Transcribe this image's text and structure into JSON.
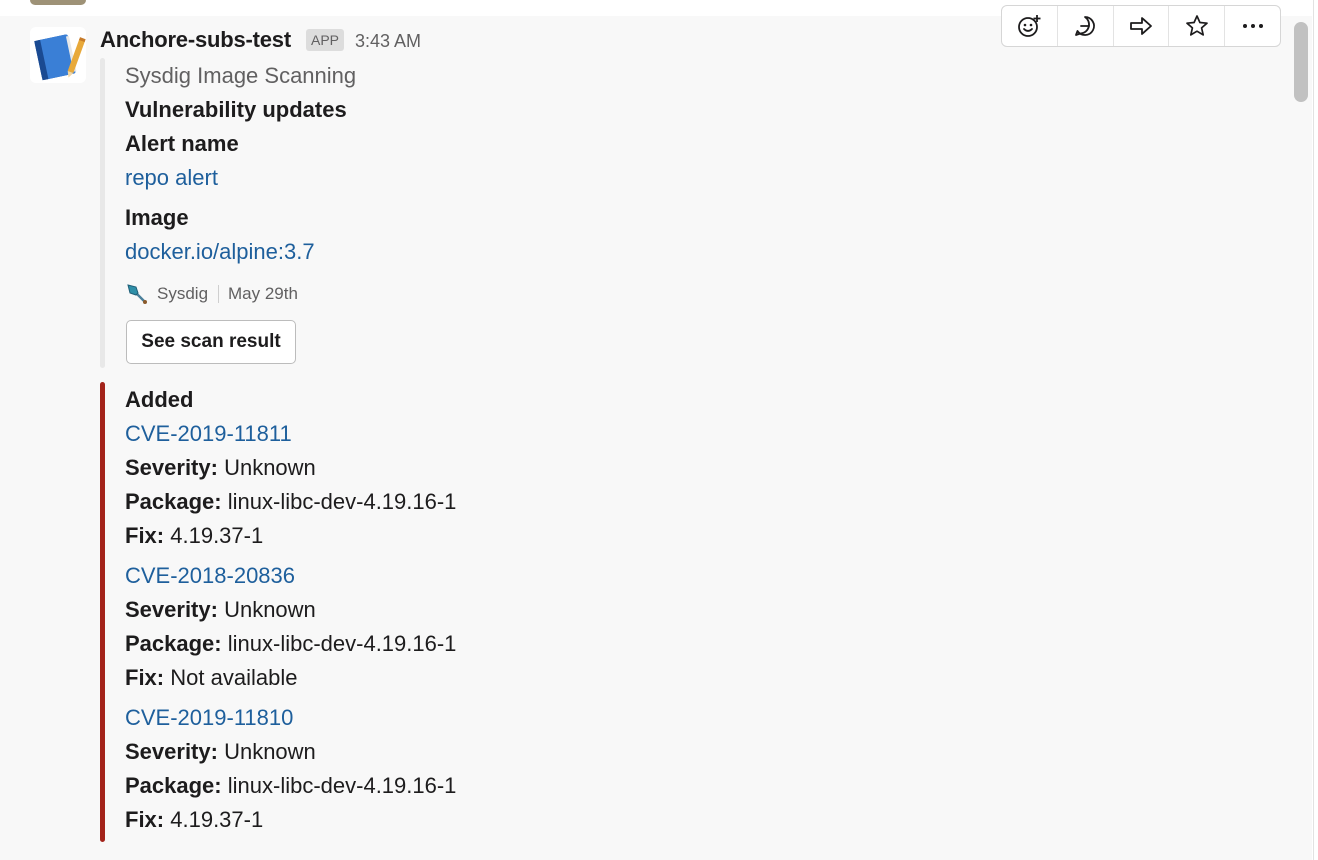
{
  "message": {
    "sender": "Anchore-subs-test",
    "badge": "APP",
    "time": "3:43 AM"
  },
  "attachment": {
    "pretext": "Sysdig Image Scanning",
    "title": "Vulnerability updates",
    "alert_label": "Alert name",
    "alert_value": "repo alert",
    "image_label": "Image",
    "image_value": "docker.io/alpine:3.7",
    "footer": "Sysdig",
    "footer_date": "May 29th",
    "button": "See scan result"
  },
  "added": {
    "title": "Added",
    "labels": {
      "severity": "Severity:",
      "package": "Package:",
      "fix": "Fix:"
    },
    "items": [
      {
        "cve": "CVE-2019-11811",
        "severity": "Unknown",
        "package": "linux-libc-dev-4.19.16-1",
        "fix": "4.19.37-1"
      },
      {
        "cve": "CVE-2018-20836",
        "severity": "Unknown",
        "package": "linux-libc-dev-4.19.16-1",
        "fix": "Not available"
      },
      {
        "cve": "CVE-2019-11810",
        "severity": "Unknown",
        "package": "linux-libc-dev-4.19.16-1",
        "fix": "4.19.37-1"
      }
    ]
  },
  "toolbar": {
    "icons": [
      "add-reaction-icon",
      "reply-in-thread-icon",
      "share-message-icon",
      "star-icon",
      "more-actions-icon"
    ]
  },
  "colors": {
    "link": "#1e5f9c",
    "added_bar": "#a3231a",
    "message_bg": "#f8f8f8"
  }
}
